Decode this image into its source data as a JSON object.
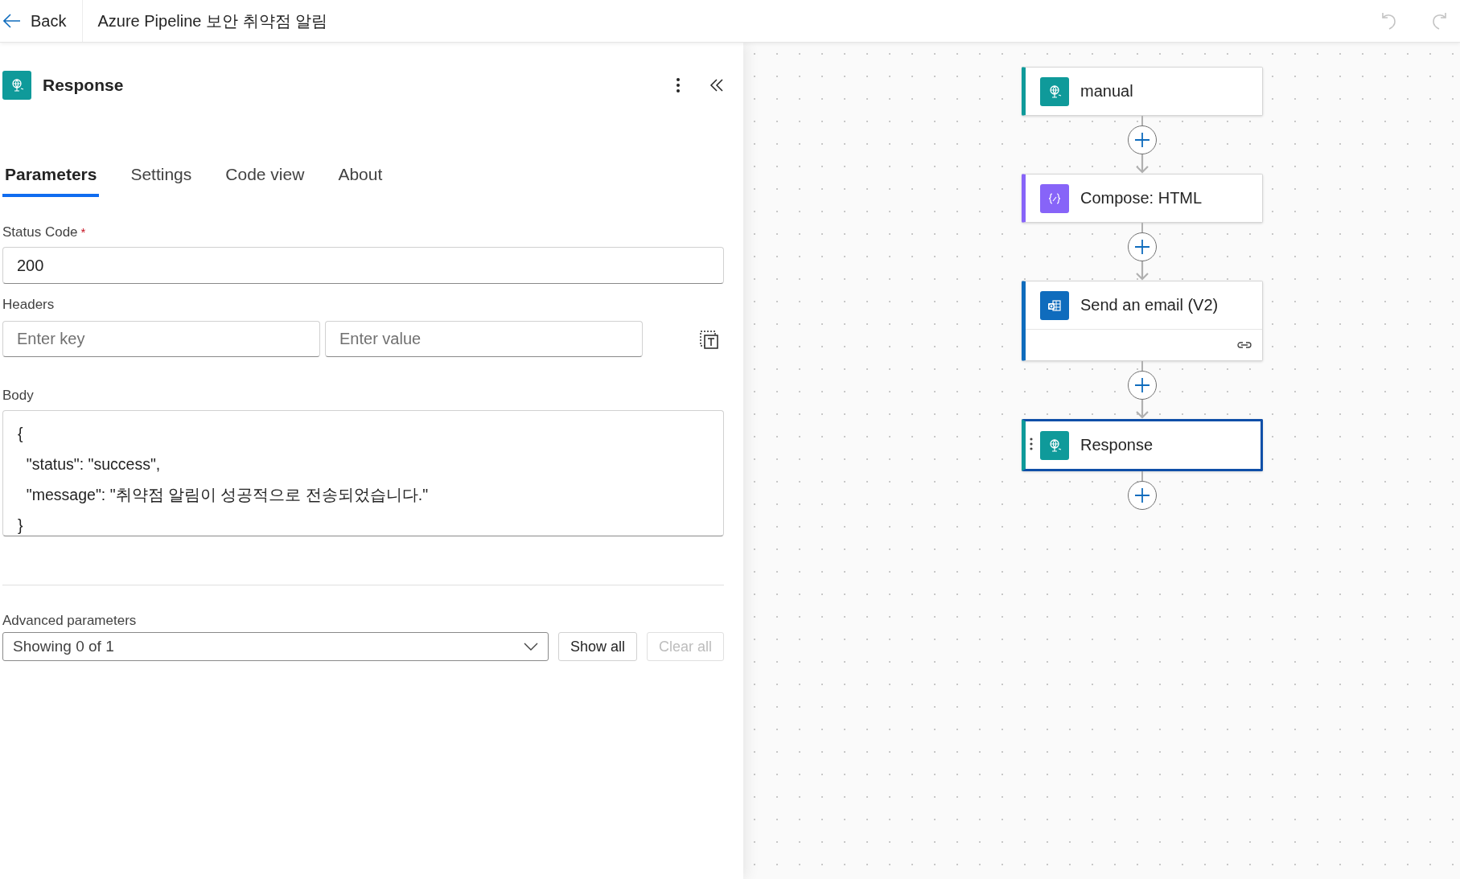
{
  "header": {
    "back": "Back",
    "title": "Azure Pipeline 보안 취약점 알림"
  },
  "panel": {
    "title": "Response",
    "tabs": [
      {
        "label": "Parameters",
        "selected": true
      },
      {
        "label": "Settings",
        "selected": false
      },
      {
        "label": "Code view",
        "selected": false
      },
      {
        "label": "About",
        "selected": false
      }
    ],
    "status_code": {
      "label": "Status Code",
      "required_mark": "*",
      "value": "200"
    },
    "headers": {
      "label": "Headers",
      "key_placeholder": "Enter key",
      "value_placeholder": "Enter value"
    },
    "body": {
      "label": "Body",
      "lines": [
        "{",
        "  \"status\": \"success\",",
        "  \"message\": \"취약점 알림이 성공적으로 전송되었습니다.\"",
        "}"
      ]
    },
    "advanced": {
      "label": "Advanced parameters",
      "value": "Showing 0 of 1",
      "show_all": {
        "label": "Show all",
        "disabled": false
      },
      "clear_all": {
        "label": "Clear all",
        "disabled": true
      }
    }
  },
  "canvas": {
    "nodes": [
      {
        "title": "manual",
        "kind": "request",
        "color": "#0f9a9a",
        "selected": false,
        "connection": false
      },
      {
        "title": "Compose: HTML",
        "kind": "compose",
        "color": "#8764f8",
        "selected": false,
        "connection": false
      },
      {
        "title": "Send an email (V2)",
        "kind": "outlook",
        "color": "#0f6cbd",
        "selected": false,
        "connection": true
      },
      {
        "title": "Response",
        "kind": "request",
        "color": "#0f9a9a",
        "selected": true,
        "connection": false
      }
    ]
  }
}
